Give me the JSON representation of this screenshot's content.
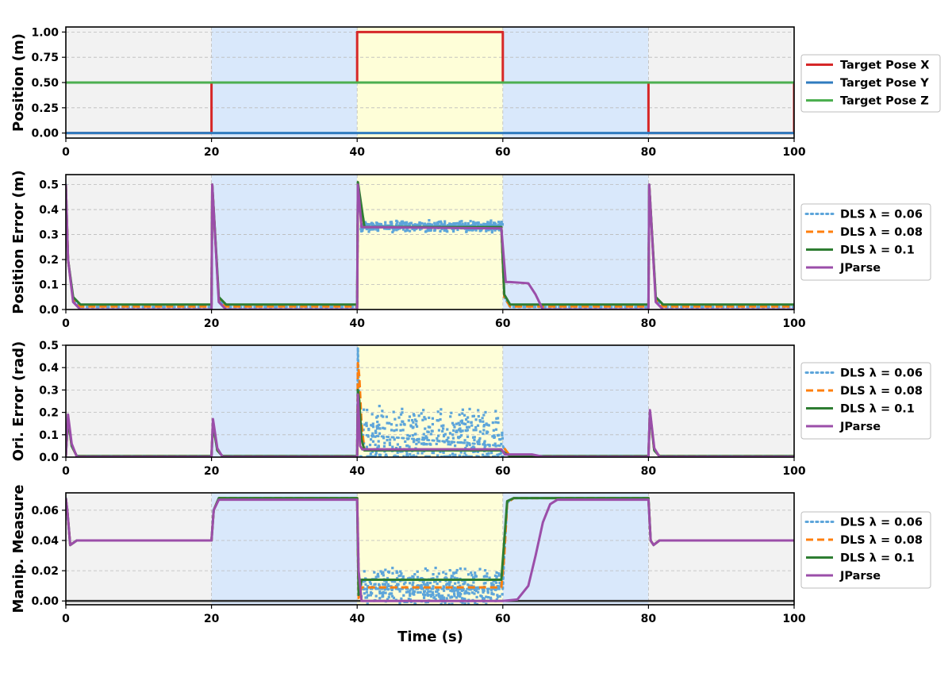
{
  "colors": {
    "red": "#d62728",
    "blue": "#2f7bbf",
    "green": "#4caf50",
    "dls006": "#5da5da",
    "dls008": "#ff7f0e",
    "dls01": "#2e7d32",
    "jparse": "#9b4ea9",
    "bg_gray": "#f2f2f2",
    "bg_blue": "#d9e8fb",
    "bg_yellow": "#fefed8",
    "grid": "#bbbbbb"
  },
  "chart_data": [
    {
      "type": "line",
      "ylabel": "Position (m)",
      "xlabel": "",
      "xlim": [
        0,
        100
      ],
      "ylim": [
        -0.05,
        1.05
      ],
      "yticks": [
        0.0,
        0.25,
        0.5,
        0.75,
        1.0
      ],
      "ytick_labels": [
        "0.00",
        "0.25",
        "0.50",
        "0.75",
        "1.00"
      ],
      "xticks": [
        0,
        20,
        40,
        60,
        80,
        100
      ],
      "grid": true,
      "legend_position": "right",
      "background_regions": [
        {
          "x": [
            0,
            20
          ],
          "color": "gray"
        },
        {
          "x": [
            20,
            40
          ],
          "color": "blue"
        },
        {
          "x": [
            40,
            60
          ],
          "color": "yellow"
        },
        {
          "x": [
            60,
            80
          ],
          "color": "blue"
        },
        {
          "x": [
            80,
            100
          ],
          "color": "gray"
        }
      ],
      "series": [
        {
          "name": "Target Pose X",
          "style": "solid",
          "color": "red",
          "x": [
            0,
            20,
            20,
            40,
            40,
            60,
            60,
            80,
            80,
            100,
            100
          ],
          "y": [
            0,
            0,
            0.5,
            0.5,
            1.0,
            1.0,
            0.5,
            0.5,
            0,
            0,
            0.5
          ]
        },
        {
          "name": "Target Pose Y",
          "style": "solid",
          "color": "blue",
          "x": [
            0,
            100
          ],
          "y": [
            0,
            0
          ]
        },
        {
          "name": "Target Pose Z",
          "style": "solid",
          "color": "green",
          "x": [
            0,
            100
          ],
          "y": [
            0.5,
            0.5
          ]
        }
      ]
    },
    {
      "type": "line",
      "ylabel": "Position Error (m)",
      "xlabel": "",
      "xlim": [
        0,
        100
      ],
      "ylim": [
        0,
        0.54
      ],
      "yticks": [
        0.0,
        0.1,
        0.2,
        0.3,
        0.4,
        0.5
      ],
      "ytick_labels": [
        "0.0",
        "0.1",
        "0.2",
        "0.3",
        "0.4",
        "0.5"
      ],
      "xticks": [
        0,
        20,
        40,
        60,
        80,
        100
      ],
      "grid": true,
      "legend_position": "right",
      "background_regions": [
        {
          "x": [
            0,
            20
          ],
          "color": "gray"
        },
        {
          "x": [
            20,
            40
          ],
          "color": "blue"
        },
        {
          "x": [
            40,
            60
          ],
          "color": "yellow"
        },
        {
          "x": [
            60,
            80
          ],
          "color": "blue"
        },
        {
          "x": [
            80,
            100
          ],
          "color": "gray"
        }
      ],
      "series": [
        {
          "name": "DLS λ = 0.06",
          "style": "dotted",
          "color": "dls006",
          "x": [
            0,
            0.3,
            1,
            2,
            20,
            20.1,
            21,
            22,
            40,
            40.1,
            40.6,
            41,
            45,
            50,
            55,
            59.8,
            60.2,
            61,
            62,
            80,
            80.1,
            81,
            82,
            100
          ],
          "y": [
            0.5,
            0.2,
            0.04,
            0.01,
            0.01,
            0.5,
            0.04,
            0.01,
            0.01,
            0.5,
            0.4,
            0.34,
            0.33,
            0.335,
            0.33,
            0.33,
            0.05,
            0.01,
            0.01,
            0.01,
            0.5,
            0.04,
            0.01,
            0.01
          ],
          "noise": {
            "x": [
              40.5,
              60
            ],
            "center": 0.333,
            "amplitude": 0.025
          }
        },
        {
          "name": "DLS λ = 0.08",
          "style": "dashed",
          "color": "dls008",
          "x": [
            0,
            0.3,
            1,
            2,
            20,
            20.1,
            21,
            22,
            40,
            40.1,
            41,
            59.8,
            60.2,
            61,
            62,
            80,
            80.1,
            81,
            82,
            100
          ],
          "y": [
            0.5,
            0.2,
            0.04,
            0.012,
            0.012,
            0.5,
            0.04,
            0.012,
            0.012,
            0.5,
            0.33,
            0.328,
            0.05,
            0.012,
            0.012,
            0.012,
            0.5,
            0.04,
            0.012,
            0.012
          ]
        },
        {
          "name": "DLS λ = 0.1",
          "style": "solid",
          "color": "dls01",
          "x": [
            0,
            0.3,
            1,
            2,
            20,
            20.1,
            21,
            22,
            40,
            40.1,
            41,
            59.8,
            60.2,
            61,
            62,
            80,
            80.1,
            81,
            82,
            100
          ],
          "y": [
            0.5,
            0.2,
            0.05,
            0.02,
            0.02,
            0.5,
            0.05,
            0.02,
            0.02,
            0.51,
            0.33,
            0.33,
            0.06,
            0.02,
            0.02,
            0.02,
            0.5,
            0.05,
            0.02,
            0.02
          ]
        },
        {
          "name": "JParse",
          "style": "solid",
          "color": "jparse",
          "x": [
            0,
            0.3,
            1,
            2,
            20,
            20.1,
            21,
            22,
            40,
            40.1,
            40.6,
            59.8,
            60.4,
            61,
            63.5,
            64.5,
            65.5,
            80,
            80.1,
            81,
            82,
            100
          ],
          "y": [
            0.5,
            0.2,
            0.03,
            0.0,
            0.0,
            0.5,
            0.03,
            0.0,
            0.0,
            0.5,
            0.33,
            0.325,
            0.11,
            0.11,
            0.105,
            0.06,
            0.0,
            0.0,
            0.5,
            0.03,
            0.0,
            0.0
          ]
        }
      ]
    },
    {
      "type": "line",
      "ylabel": "Ori. Error (rad)",
      "xlabel": "",
      "xlim": [
        0,
        100
      ],
      "ylim": [
        0,
        0.5
      ],
      "yticks": [
        0.0,
        0.1,
        0.2,
        0.3,
        0.4,
        0.5
      ],
      "ytick_labels": [
        "0.0",
        "0.1",
        "0.2",
        "0.3",
        "0.4",
        "0.5"
      ],
      "xticks": [
        0,
        20,
        40,
        60,
        80,
        100
      ],
      "grid": true,
      "legend_position": "right",
      "background_regions": [
        {
          "x": [
            0,
            20
          ],
          "color": "gray"
        },
        {
          "x": [
            20,
            40
          ],
          "color": "blue"
        },
        {
          "x": [
            40,
            60
          ],
          "color": "yellow"
        },
        {
          "x": [
            60,
            80
          ],
          "color": "blue"
        },
        {
          "x": [
            80,
            100
          ],
          "color": "gray"
        }
      ],
      "series": [
        {
          "name": "DLS λ = 0.06",
          "style": "dotted",
          "color": "dls006",
          "x": [
            0,
            0.3,
            0.8,
            1.5,
            20,
            20.2,
            20.8,
            21.5,
            40,
            40.1,
            40.4,
            60,
            60.3,
            61,
            80,
            80.2,
            80.8,
            81.5,
            100
          ],
          "y": [
            0.005,
            0.17,
            0.05,
            0.005,
            0.005,
            0.15,
            0.03,
            0.005,
            0.005,
            0.49,
            0.1,
            0.05,
            0.03,
            0.005,
            0.005,
            0.2,
            0.03,
            0.005,
            0.005
          ],
          "noise": {
            "x": [
              40.4,
              60
            ],
            "center": 0.08,
            "amplitude": 0.16
          }
        },
        {
          "name": "DLS λ = 0.08",
          "style": "dashed",
          "color": "dls008",
          "x": [
            0,
            0.3,
            0.8,
            1.5,
            20,
            20.2,
            20.8,
            21.5,
            40,
            40.1,
            40.3,
            40.6,
            41,
            59.8,
            60.2,
            61,
            80,
            80.2,
            80.8,
            81.5,
            100
          ],
          "y": [
            0.005,
            0.17,
            0.05,
            0.005,
            0.005,
            0.15,
            0.03,
            0.005,
            0.005,
            0.42,
            0.36,
            0.15,
            0.03,
            0.03,
            0.04,
            0.005,
            0.005,
            0.2,
            0.03,
            0.005,
            0.005
          ]
        },
        {
          "name": "DLS λ = 0.1",
          "style": "solid",
          "color": "dls01",
          "x": [
            0,
            0.3,
            0.8,
            1.5,
            20,
            20.2,
            20.8,
            21.5,
            40,
            40.1,
            40.3,
            40.6,
            41,
            59.8,
            60.2,
            61,
            80,
            80.2,
            80.8,
            81.5,
            100
          ],
          "y": [
            0.005,
            0.17,
            0.05,
            0.005,
            0.005,
            0.15,
            0.03,
            0.005,
            0.005,
            0.3,
            0.25,
            0.08,
            0.03,
            0.03,
            0.02,
            0.005,
            0.005,
            0.2,
            0.03,
            0.005,
            0.005
          ]
        },
        {
          "name": "JParse",
          "style": "solid",
          "color": "jparse",
          "x": [
            0,
            0.3,
            0.8,
            1.5,
            20,
            20.2,
            20.8,
            21.5,
            40,
            40.1,
            40.4,
            40.7,
            59.8,
            60.3,
            64,
            65.5,
            80,
            80.2,
            80.8,
            81.5,
            100
          ],
          "y": [
            0.002,
            0.19,
            0.06,
            0.002,
            0.002,
            0.17,
            0.04,
            0.002,
            0.002,
            0.28,
            0.05,
            0.035,
            0.035,
            0.012,
            0.012,
            0.002,
            0.002,
            0.21,
            0.04,
            0.002,
            0.002
          ]
        }
      ]
    },
    {
      "type": "line",
      "ylabel": "Manip. Measure",
      "xlabel": "Time (s)",
      "xlim": [
        0,
        100
      ],
      "ylim": [
        -0.0025,
        0.0715
      ],
      "yticks": [
        0.0,
        0.02,
        0.04,
        0.06
      ],
      "ytick_labels": [
        "0.00",
        "0.02",
        "0.04",
        "0.06"
      ],
      "xticks": [
        0,
        20,
        40,
        60,
        80,
        100
      ],
      "grid": true,
      "legend_position": "right",
      "background_regions": [
        {
          "x": [
            0,
            20
          ],
          "color": "gray"
        },
        {
          "x": [
            20,
            40
          ],
          "color": "blue"
        },
        {
          "x": [
            40,
            60
          ],
          "color": "yellow"
        },
        {
          "x": [
            60,
            80
          ],
          "color": "blue"
        },
        {
          "x": [
            80,
            100
          ],
          "color": "gray"
        }
      ],
      "reference_line": {
        "y": 0.0,
        "color": "#333333"
      },
      "series": [
        {
          "name": "DLS λ = 0.06",
          "style": "dotted",
          "color": "dls006",
          "x": [
            0,
            0.2,
            0.6,
            1.5,
            20,
            20.3,
            21,
            40,
            40.2,
            40.5,
            60,
            60.2,
            60.6,
            61.5,
            80,
            80.3,
            80.7,
            81.5,
            100
          ],
          "y": [
            0.068,
            0.06,
            0.037,
            0.04,
            0.04,
            0.06,
            0.068,
            0.068,
            0.02,
            0.008,
            0.008,
            0.03,
            0.065,
            0.068,
            0.068,
            0.04,
            0.037,
            0.04,
            0.04
          ],
          "noise": {
            "x": [
              40.5,
              60
            ],
            "center": 0.009,
            "amplitude": 0.014
          }
        },
        {
          "name": "DLS λ = 0.08",
          "style": "dashed",
          "color": "dls008",
          "x": [
            0,
            0.2,
            0.6,
            1.5,
            20,
            20.3,
            21,
            40,
            40.2,
            40.6,
            59.8,
            60.2,
            60.6,
            61.5,
            80,
            80.3,
            80.7,
            81.5,
            100
          ],
          "y": [
            0.068,
            0.06,
            0.037,
            0.04,
            0.04,
            0.06,
            0.068,
            0.068,
            0.002,
            0.009,
            0.009,
            0.03,
            0.065,
            0.068,
            0.068,
            0.04,
            0.037,
            0.04,
            0.04
          ]
        },
        {
          "name": "DLS λ = 0.1",
          "style": "solid",
          "color": "dls01",
          "x": [
            0,
            0.2,
            0.6,
            1.5,
            20,
            20.3,
            21,
            40,
            40.2,
            40.6,
            59.8,
            60.2,
            60.6,
            61.5,
            80,
            80.3,
            80.7,
            81.5,
            100
          ],
          "y": [
            0.068,
            0.06,
            0.037,
            0.04,
            0.04,
            0.06,
            0.068,
            0.068,
            0.004,
            0.014,
            0.014,
            0.04,
            0.066,
            0.068,
            0.068,
            0.04,
            0.037,
            0.04,
            0.04
          ]
        },
        {
          "name": "JParse",
          "style": "solid",
          "color": "jparse",
          "x": [
            0,
            0.2,
            0.6,
            1.5,
            20,
            20.3,
            21,
            40,
            40.2,
            40.6,
            60,
            62,
            63.5,
            64.5,
            65.5,
            66.5,
            67.5,
            80,
            80.3,
            80.7,
            81.5,
            100
          ],
          "y": [
            0.068,
            0.06,
            0.037,
            0.04,
            0.04,
            0.06,
            0.067,
            0.067,
            0.02,
            0.0,
            0.0,
            0.001,
            0.01,
            0.03,
            0.052,
            0.064,
            0.067,
            0.067,
            0.04,
            0.037,
            0.04,
            0.04
          ]
        }
      ]
    }
  ]
}
